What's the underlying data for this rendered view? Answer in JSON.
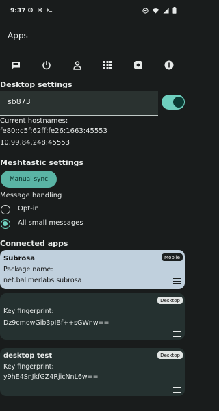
{
  "status_bar": {
    "time": "9:37",
    "left_icons": [
      "settings-icon",
      "bluetooth-icon",
      "terminal-icon"
    ],
    "right_icons": [
      "do-not-disturb-icon",
      "wifi-icon",
      "signal-icon",
      "battery-icon"
    ]
  },
  "app_bar": {
    "title": "Apps"
  },
  "toolbar": {
    "icons": [
      "message-icon",
      "power-icon",
      "person-icon",
      "apps-grid-icon",
      "settings-icon",
      "info-icon"
    ]
  },
  "desktop_settings": {
    "title": "Desktop settings",
    "hostname_value": "sb873",
    "toggle_on": true,
    "hostnames_label": "Current hostnames:",
    "hostnames": [
      "fe80::c5f:62ff:fe26:1663:45553",
      "10.99.84.248:45553"
    ]
  },
  "meshtastic": {
    "title": "Meshtastic settings",
    "sync_label": "Manual sync",
    "handling_label": "Message handling",
    "options": [
      {
        "label": "Opt-in",
        "selected": false
      },
      {
        "label": "All small messages",
        "selected": true
      }
    ]
  },
  "connected_apps": {
    "title": "Connected apps",
    "apps": [
      {
        "name": "Subrosa",
        "line1": "Package name:",
        "line2": "net.ballmerlabs.subrosa",
        "badge": "Mobile",
        "highlighted": true
      },
      {
        "name": "",
        "line1": "Key fingerprint:",
        "line2": "Dz9cmowGib3pIBf++sGWnw==",
        "badge": "Desktop",
        "highlighted": false
      },
      {
        "name": "desktop test",
        "line1": "Key fingerprint:",
        "line2": "y9hE4SnJkfGZ4RjicNnL6w==",
        "badge": "Desktop",
        "highlighted": false
      }
    ]
  },
  "colors": {
    "background": "#191c1c",
    "accent": "#6fd0bf",
    "button": "#5ab4a5",
    "card_highlight": "#c0d0dd",
    "card_default": "#253130"
  }
}
